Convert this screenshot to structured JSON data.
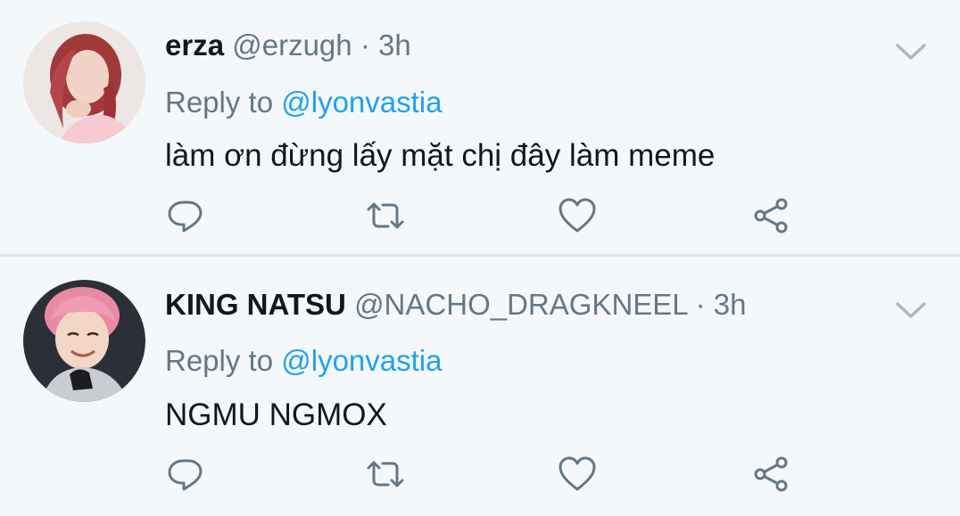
{
  "theme": {
    "background": "#f5f8fa",
    "name_color": "#14171a",
    "muted_color": "#657786",
    "mention_color": "#1da1f2",
    "divider_color": "#dfe4e8"
  },
  "tweets": [
    {
      "name": "erza",
      "handle": "@erzugh",
      "separator": "·",
      "time": "3h",
      "reply_prefix": "Reply to",
      "reply_mention": "@lyonvastia",
      "text": "làm ơn đừng lấy mặt chị đây làm meme"
    },
    {
      "name": "KING NATSU",
      "handle": "@NACHO_DRAGKNEEL",
      "separator": "·",
      "time": "3h",
      "reply_prefix": "Reply to",
      "reply_mention": "@lyonvastia",
      "text": "NGMU NGMOX"
    }
  ],
  "icons": {
    "menu": "chevron-down-icon",
    "reply": "reply-icon",
    "retweet": "retweet-icon",
    "like": "heart-icon",
    "share": "share-icon"
  }
}
